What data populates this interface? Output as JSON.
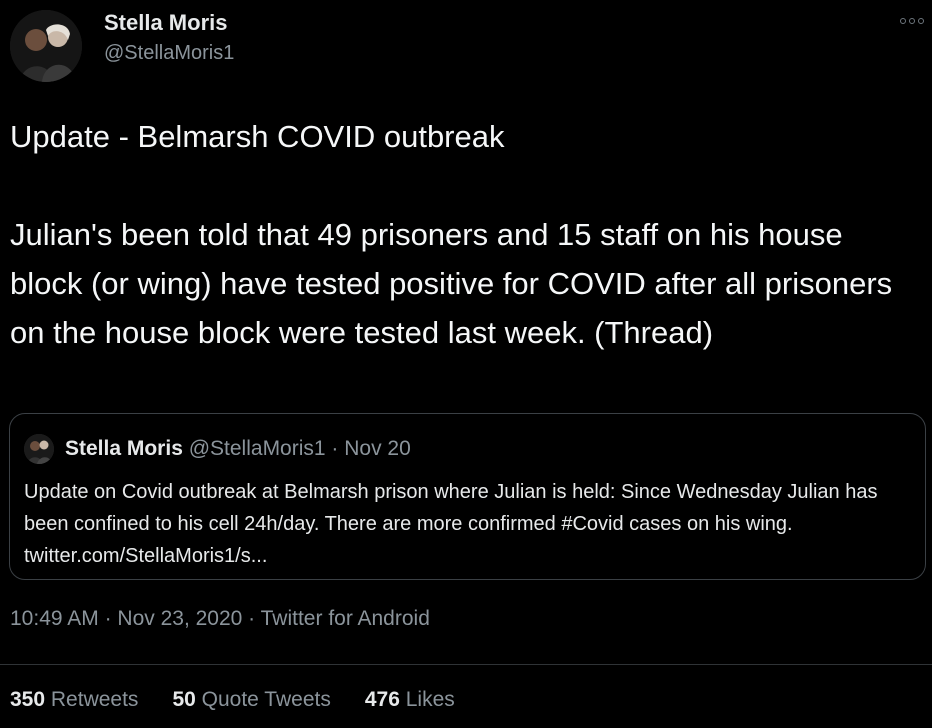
{
  "author": {
    "name": "Stella Moris",
    "handle": "@StellaMoris1"
  },
  "tweet": {
    "text": "Update - Belmarsh COVID outbreak\n\nJulian's been told that 49 prisoners and 15 staff on his house block (or wing) have tested positive for COVID after all prisoners on the house block were tested last week. (Thread)"
  },
  "quote": {
    "name": "Stella Moris",
    "handle": "@StellaMoris1",
    "separator": " · ",
    "date": "Nov 20",
    "text": "Update on Covid outbreak at Belmarsh prison where Julian is held: Since Wednesday Julian has been confined to his cell 24h/day. There are more confirmed #Covid cases on his wing. twitter.com/StellaMoris1/s..."
  },
  "meta": {
    "time": "10:49 AM",
    "sep1": " · ",
    "date": "Nov 23, 2020",
    "sep2": " · ",
    "source": "Twitter for Android"
  },
  "stats": {
    "retweets_count": "350",
    "retweets_label": "Retweets",
    "quotes_count": "50",
    "quotes_label": "Quote Tweets",
    "likes_count": "476",
    "likes_label": "Likes"
  },
  "icons": {
    "more": "more-options-icon"
  },
  "colors": {
    "background": "#000000",
    "text": "#e7e9ea",
    "secondary": "#8b949b",
    "border": "#3b4045"
  }
}
